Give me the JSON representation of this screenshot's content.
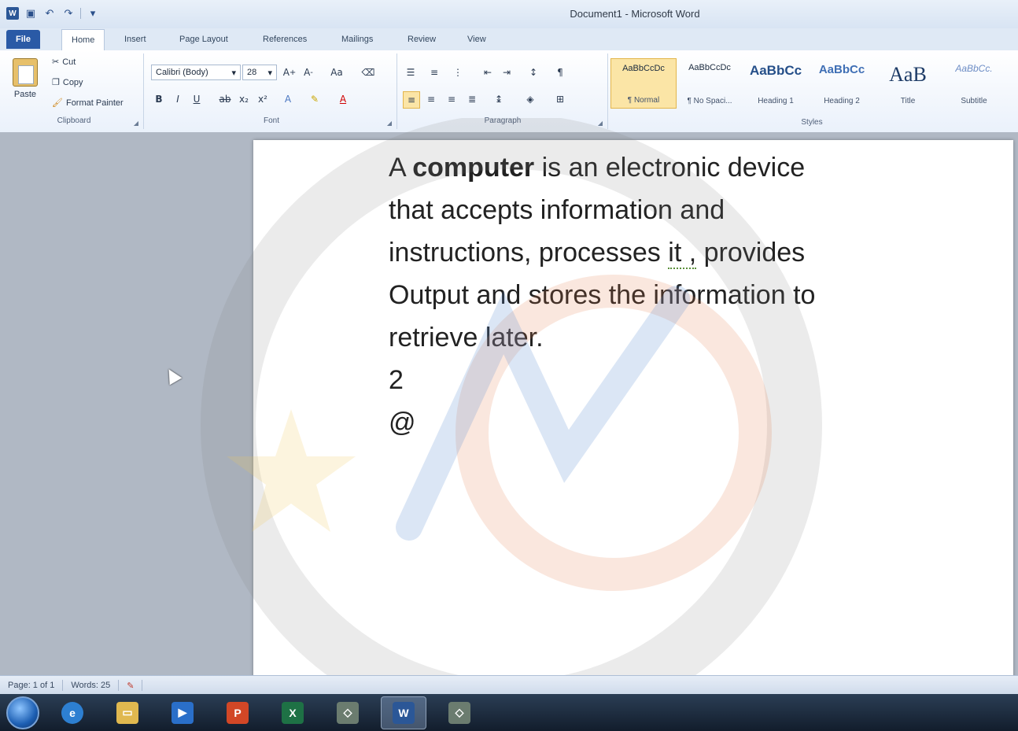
{
  "window": {
    "title": "Document1 - Microsoft Word"
  },
  "qat": {
    "logo": "W"
  },
  "tabs": [
    "File",
    "Home",
    "Insert",
    "Page Layout",
    "References",
    "Mailings",
    "Review",
    "View"
  ],
  "clipboard": {
    "paste": "Paste",
    "cut": "Cut",
    "copy": "Copy",
    "format_painter": "Format Painter",
    "label": "Clipboard"
  },
  "font": {
    "name": "Calibri (Body)",
    "size": "28",
    "label": "Font"
  },
  "paragraph": {
    "label": "Paragraph"
  },
  "styles": {
    "label": "Styles",
    "items": [
      {
        "sample": "AaBbCcDc",
        "name": "¶ Normal"
      },
      {
        "sample": "AaBbCcDc",
        "name": "¶ No Spaci..."
      },
      {
        "sample": "AaBbCc",
        "name": "Heading 1"
      },
      {
        "sample": "AaBbCc",
        "name": "Heading 2"
      },
      {
        "sample": "AaB",
        "name": "Title"
      },
      {
        "sample": "AaBbCc.",
        "name": "Subtitle"
      }
    ]
  },
  "document": {
    "line1_pre": "A ",
    "line1_bold": "computer",
    "line1_post": " is an electronic device",
    "line2": "that accepts information and",
    "line3_pre": "instructions, processes ",
    "line3_squiggle": "it ,",
    "line3_post": " provides",
    "line4": "Output  and stores the information to",
    "line5": "retrieve later.",
    "line6": "2",
    "line7": "@"
  },
  "status": {
    "page": "Page: 1 of 1",
    "words": "Words: 25"
  },
  "taskbar": {
    "word_label": "W"
  }
}
